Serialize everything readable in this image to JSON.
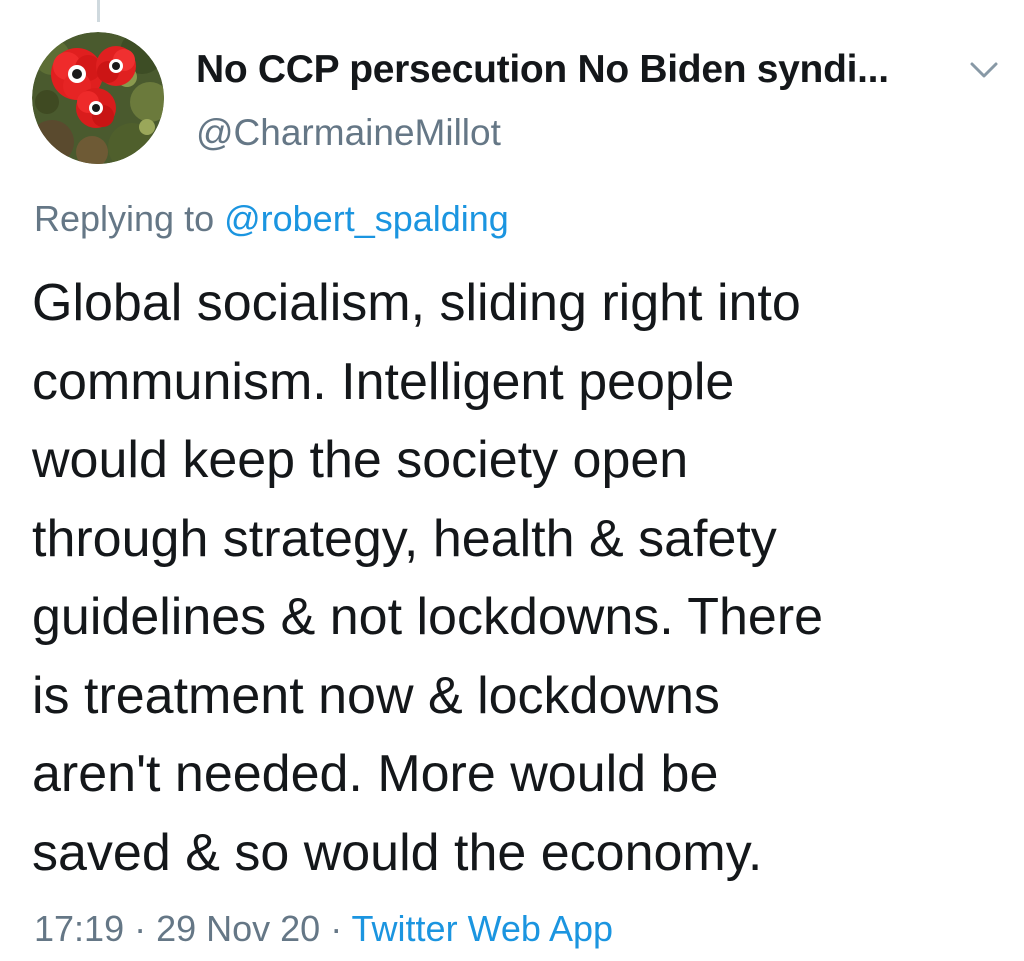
{
  "tweet": {
    "author": {
      "display_name": "No CCP persecution No Biden syndi...",
      "handle": "@CharmaineMillot",
      "avatar": "red-anemone-flowers-avatar"
    },
    "more_icon": "chevron-down-icon",
    "reply": {
      "prefix": "Replying to ",
      "mention": "@robert_spalding"
    },
    "text_lines": [
      "Global socialism, sliding right into",
      "communism. Intelligent people",
      "would keep the society open",
      "through strategy, health & safety",
      "guidelines & not lockdowns. There",
      "is treatment now & lockdowns",
      "aren't needed. More would be",
      "saved & so would the economy."
    ],
    "time": "17:19",
    "separator": " · ",
    "date": "29 Nov 20",
    "source": "Twitter Web App"
  },
  "colors": {
    "text": "#14171a",
    "secondary": "#657786",
    "link": "#1b95e0",
    "thread_line": "#cfd9de"
  }
}
